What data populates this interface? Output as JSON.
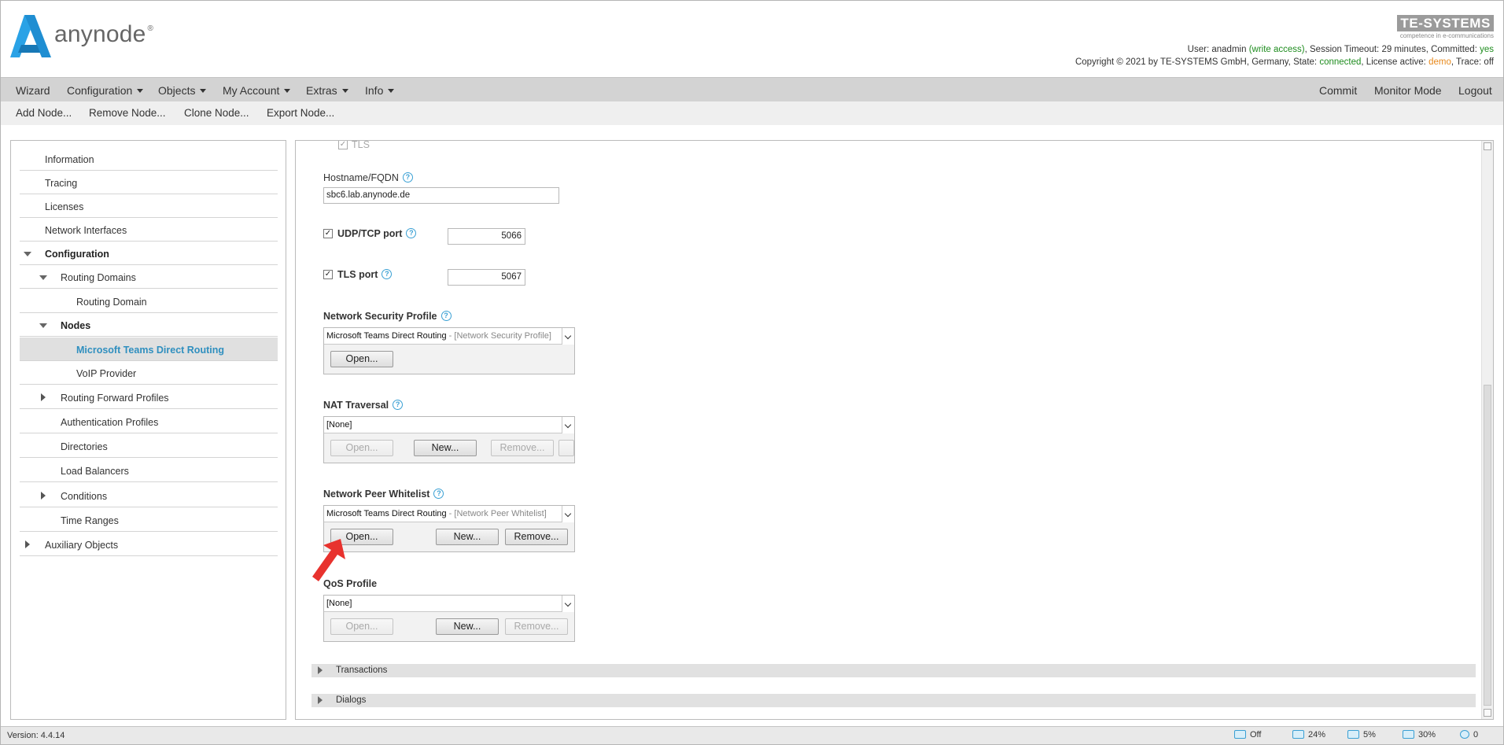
{
  "header": {
    "brand": "anynode",
    "brand_reg": "®",
    "company_logo": "TE-SYSTEMS",
    "company_tagline": "competence in e-communications",
    "status_line1": {
      "user_label": "User:",
      "user": "anadmin",
      "access": "(write access)",
      "session_label": ", Session Timeout:",
      "session": "29 minutes",
      "committed_label": ", Committed:",
      "committed": "yes"
    },
    "status_line2": {
      "copyright": "Copyright © 2021 by TE-SYSTEMS GmbH, Germany, State:",
      "state": "connected",
      "license_label": ", License active:",
      "license": "demo",
      "trace_label": ", Trace:",
      "trace": "off"
    }
  },
  "menubar": {
    "wizard": "Wizard",
    "configuration": "Configuration",
    "objects": "Objects",
    "my_account": "My Account",
    "extras": "Extras",
    "info": "Info",
    "commit": "Commit",
    "monitor_mode": "Monitor Mode",
    "logout": "Logout"
  },
  "toolbar": {
    "add_node": "Add Node...",
    "remove_node": "Remove Node...",
    "clone_node": "Clone Node...",
    "export_node": "Export Node..."
  },
  "sidebar": {
    "information": "Information",
    "tracing": "Tracing",
    "licenses": "Licenses",
    "network_interfaces": "Network Interfaces",
    "configuration": "Configuration",
    "routing_domains": "Routing Domains",
    "routing_domain": "Routing Domain",
    "nodes": "Nodes",
    "ms_teams": "Microsoft Teams Direct Routing",
    "voip_provider": "VoIP Provider",
    "routing_forward_profiles": "Routing Forward Profiles",
    "authentication_profiles": "Authentication Profiles",
    "directories": "Directories",
    "load_balancers": "Load Balancers",
    "conditions": "Conditions",
    "time_ranges": "Time Ranges",
    "auxiliary_objects": "Auxiliary Objects"
  },
  "form": {
    "tls_label": "TLS",
    "hostname_label": "Hostname/FQDN",
    "hostname_value": "sbc6.lab.anynode.de",
    "udp_tcp_label": "UDP/TCP port",
    "udp_tcp_value": "5066",
    "tls_port_label": "TLS port",
    "tls_port_value": "5067",
    "nsp_label": "Network Security Profile",
    "nsp_value": "Microsoft Teams Direct Routing",
    "nsp_type": " - [Network Security Profile]",
    "nat_label": "NAT Traversal",
    "nat_value": "[None]",
    "npw_label": "Network Peer Whitelist",
    "npw_value": "Microsoft Teams Direct Routing",
    "npw_type": " - [Network Peer Whitelist]",
    "qos_label": "QoS Profile",
    "qos_value": "[None]",
    "open": "Open...",
    "new": "New...",
    "remove": "Remove...",
    "help_glyph": "?",
    "check_glyph": "✓"
  },
  "sections": {
    "transactions": "Transactions",
    "dialogs": "Dialogs"
  },
  "footer": {
    "version": "Version:  4.4.14",
    "trace_status": "Off",
    "stat1": "24%",
    "stat2": "5%",
    "stat3": "30%",
    "alerts": "0"
  },
  "colors": {
    "logo_blue": "#1e8bd0",
    "selected_text": "#2f8fbf",
    "ok_green": "#1e8c1e",
    "demo_orange": "#e8891c",
    "annotation_red": "#e8322e"
  }
}
